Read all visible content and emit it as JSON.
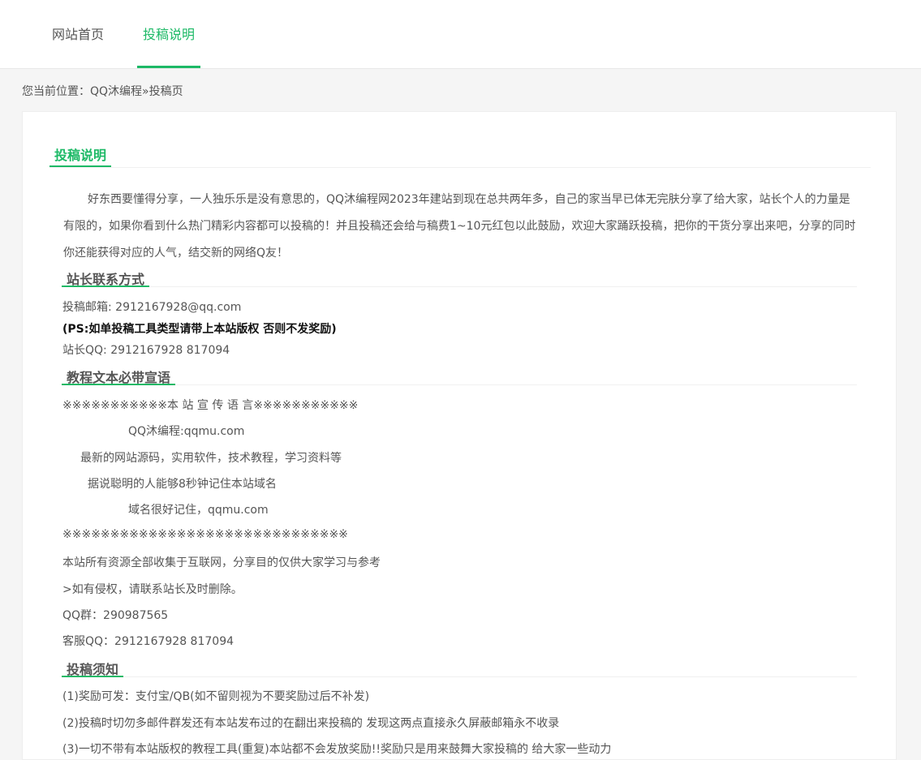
{
  "nav": {
    "items": [
      {
        "label": "网站首页"
      },
      {
        "label": "投稿说明"
      }
    ]
  },
  "breadcrumb": {
    "prefix": "您当前位置：",
    "site": "QQ沐编程",
    "sep": "»",
    "current": "投稿页"
  },
  "main_title": "投稿说明",
  "intro": "好东西要懂得分享，一人独乐乐是没有意思的，QQ沐编程网2023年建站到现在总共两年多，自己的家当早已体无完肤分享了给大家，站长个人的力量是有限的，如果你看到什么热门精彩内容都可以投稿的！并且投稿还会给与稿费1~10元红包以此鼓励，欢迎大家踊跃投稿，把你的干货分享出来吧，分享的同时你还能获得对应的人气，结交新的网络Q友！",
  "contact": {
    "title": "站长联系方式",
    "email": "投稿邮箱: 2912167928@qq.com",
    "ps": "(PS:如单投稿工具类型请带上本站版权 否则不发奖励)",
    "qq": "站长QQ: 2912167928 817094"
  },
  "promo": {
    "title": "教程文本必带宣语",
    "lines": [
      "※※※※※※※※※※※本 站 宣 传 语 言※※※※※※※※※※※",
      "QQ沐编程:qqmu.com",
      "最新的网站源码，实用软件，技术教程，学习资料等",
      "据说聪明的人能够8秒钟记住本站域名",
      "域名很好记住，qqmu.com",
      "※※※※※※※※※※※※※※※※※※※※※※※※※※※※※※",
      "本站所有资源全部收集于互联网，分享目的仅供大家学习与参考",
      ">如有侵权，请联系站长及时删除。",
      "QQ群：290987565",
      "客服QQ：2912167928 817094"
    ]
  },
  "notice": {
    "title": "投稿须知",
    "lines": [
      "(1)奖励可发：支付宝/QB(如不留则视为不要奖励过后不补发)",
      "(2)投稿时切勿多邮件群发还有本站发布过的在翻出来投稿的 发现这两点直接永久屏蔽邮箱永不收录",
      "(3)一切不带有本站版权的教程工具(重复)本站都不会发放奖励!!奖励只是用来鼓舞大家投稿的 给大家一些动力"
    ]
  }
}
